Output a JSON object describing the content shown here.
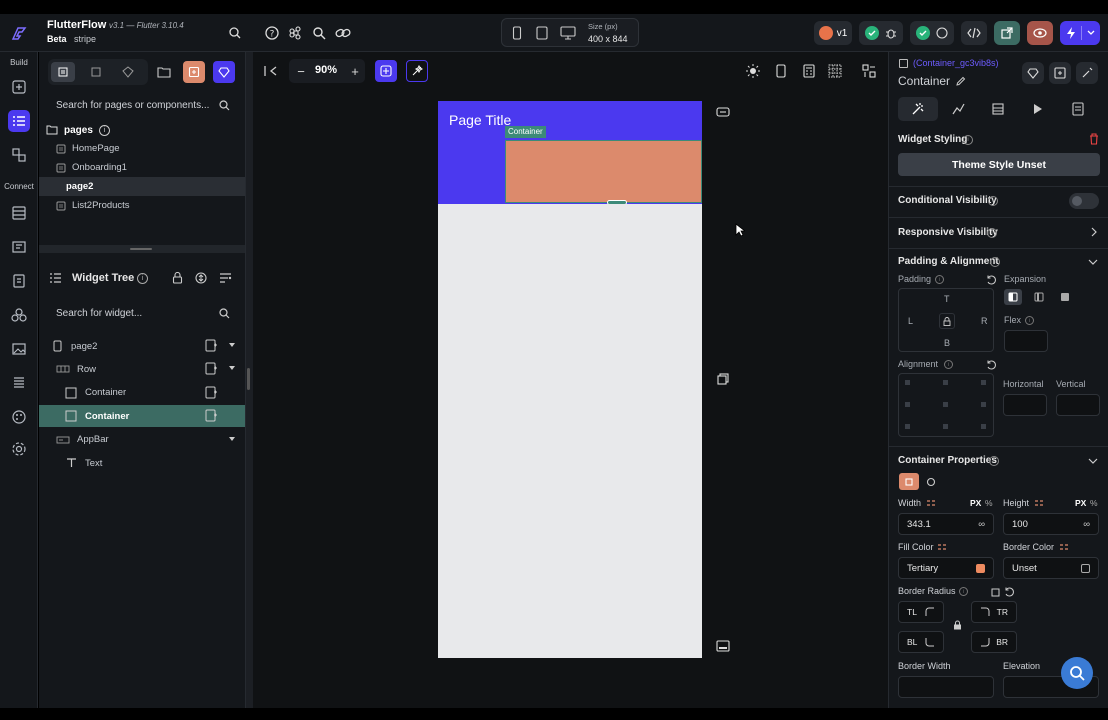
{
  "app": {
    "name": "FlutterFlow",
    "version": "v3.1 — Flutter 3.10.4",
    "tier": "Beta",
    "project": "stripe"
  },
  "device": {
    "size_label": "Size (px)",
    "size_value": "400 x 844"
  },
  "header": {
    "version_badge": "v1"
  },
  "rail": {
    "build_label": "Build",
    "connect_label": "Connect"
  },
  "pages_panel": {
    "search_placeholder": "Search for pages or components...",
    "title": "pages",
    "count_badge": "i",
    "items": [
      "HomePage",
      "Onboarding1",
      "page2",
      "List2Products"
    ],
    "selected_index": 2
  },
  "widget_tree": {
    "title": "Widget Tree",
    "search_placeholder": "Search for widget...",
    "nodes": [
      {
        "label": "page2",
        "depth": 0
      },
      {
        "label": "Row",
        "depth": 1
      },
      {
        "label": "Container",
        "depth": 2
      },
      {
        "label": "Container",
        "depth": 2
      },
      {
        "label": "AppBar",
        "depth": 1
      },
      {
        "label": "Text",
        "depth": 2
      }
    ],
    "selected_index": 3
  },
  "canvas": {
    "zoom": "90%",
    "page_title": "Page Title",
    "container_tag": "Container",
    "appbar_color": "#4b39ef",
    "container_color": "#dc8a6c",
    "page_bg": "#e8e9eb"
  },
  "properties": {
    "widget_id": "(Container_gc3vib8s)",
    "widget_type": "Container",
    "widget_styling": "Widget Styling",
    "theme_style_btn": "Theme Style Unset",
    "conditional_visibility": "Conditional Visibility",
    "responsive_visibility": "Responsive Visibility",
    "padding_alignment": "Padding & Alignment",
    "padding_label": "Padding",
    "expansion_label": "Expansion",
    "pad_t": "T",
    "pad_l": "L",
    "pad_r": "R",
    "pad_b": "B",
    "flex_label": "Flex",
    "alignment_label": "Alignment",
    "horizontal_label": "Horizontal",
    "vertical_label": "Vertical",
    "container_properties": "Container Properties",
    "width_label": "Width",
    "height_label": "Height",
    "unit_px": "PX",
    "unit_pct": "%",
    "width_value": "343.1",
    "height_value": "100",
    "inf": "∞",
    "fill_color_label": "Fill Color",
    "border_color_label": "Border Color",
    "fill_color_value": "Tertiary",
    "border_color_value": "Unset",
    "border_radius_label": "Border Radius",
    "tl": "TL",
    "tr": "TR",
    "bl": "BL",
    "br": "BR",
    "border_width_label": "Border Width",
    "elevation_label": "Elevation"
  },
  "colors": {
    "accent": "#4b39ef",
    "teal": "#3c6b63",
    "tertiary": "#ee8b60",
    "danger": "#ef4444"
  }
}
